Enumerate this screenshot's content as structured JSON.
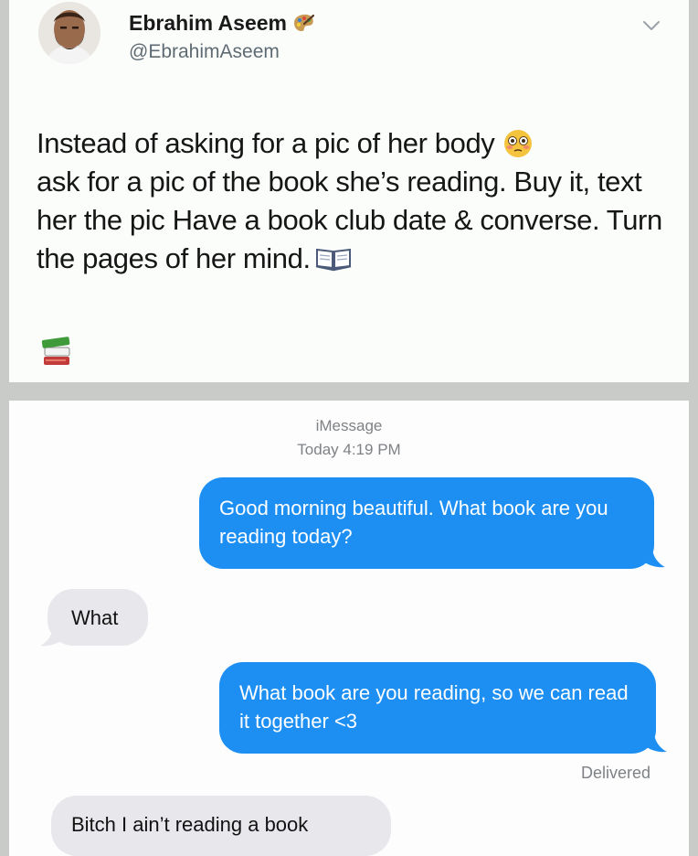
{
  "tweet": {
    "author_name": "Ebrahim Aseem",
    "author_handle": "@EbrahimAseem",
    "name_emoji": "artist-palette-emoji",
    "text_part1": "Instead of asking for a pic of her body",
    "text_part2": "ask for a pic of the book she’s reading. Buy it, text her the pic Have a book club date & converse. Turn the pages of her mind.",
    "emojis": [
      "flushed-face-emoji",
      "open-book-emoji",
      "books-emoji"
    ]
  },
  "chat": {
    "service": "iMessage",
    "timestamp": "Today 4:19 PM",
    "messages": [
      {
        "direction": "outgoing",
        "text": "Good morning beautiful. What book are you reading today?"
      },
      {
        "direction": "incoming",
        "text": "What"
      },
      {
        "direction": "outgoing",
        "text": "What book are you reading, so we can read it together <3"
      },
      {
        "direction": "incoming",
        "text": "Bitch I ain’t reading a book"
      }
    ],
    "delivered_label": "Delivered"
  },
  "colors": {
    "outgoing_bubble": "#1d8ff2",
    "incoming_bubble": "#e8e7ec",
    "page_background": "#c9cbc8"
  }
}
